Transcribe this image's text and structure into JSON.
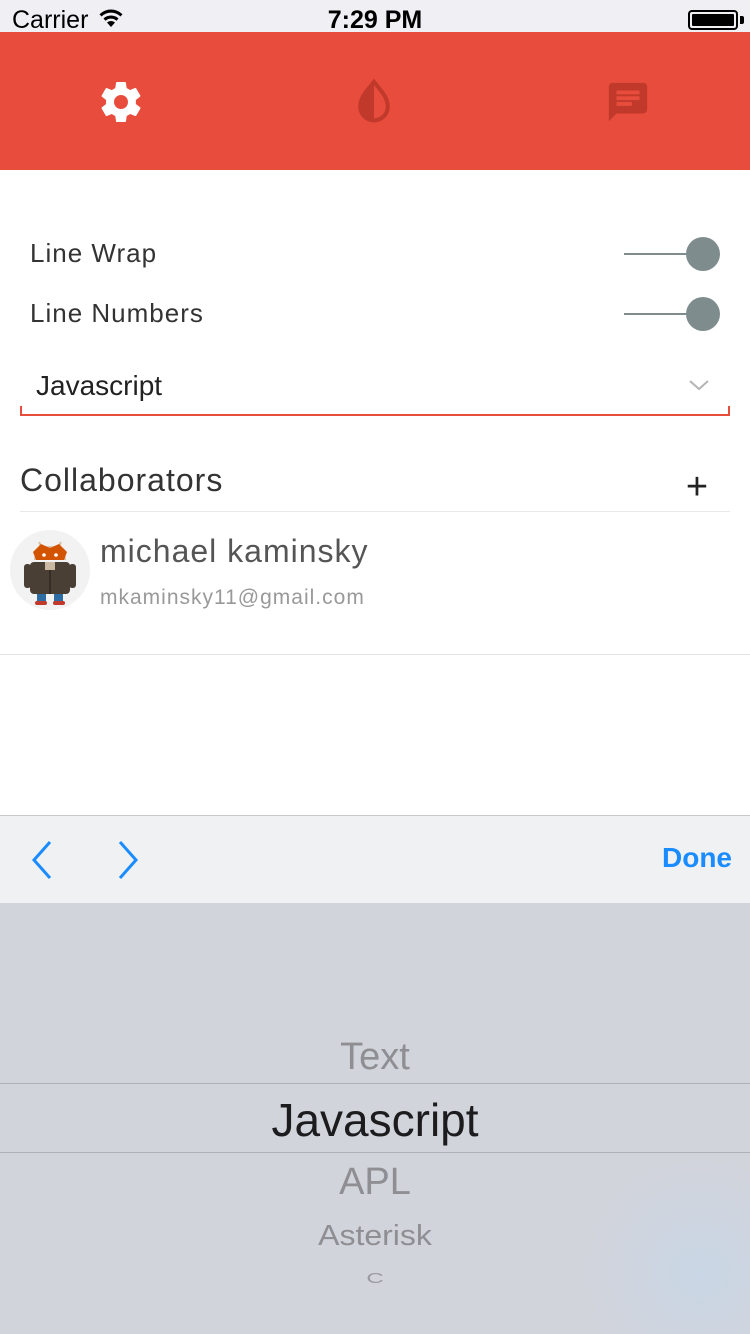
{
  "status_bar": {
    "carrier": "Carrier",
    "time": "7:29 PM",
    "battery_level": 1.0
  },
  "toolbar": {
    "accent_color": "#e84c3d",
    "icons": [
      "gear-icon",
      "contrast-drop-icon",
      "chat-icon"
    ]
  },
  "settings": {
    "line_wrap": {
      "label": "Line Wrap",
      "enabled": true
    },
    "line_numbers": {
      "label": "Line Numbers",
      "enabled": true
    },
    "language": {
      "value": "Javascript"
    }
  },
  "collaborators": {
    "title": "Collaborators",
    "add_label": "+",
    "items": [
      {
        "name": "michael kaminsky",
        "email": "mkaminsky11@gmail.com"
      }
    ]
  },
  "keyboard_accessory": {
    "done_label": "Done",
    "accent_color": "#1a8cff"
  },
  "picker": {
    "options": [
      "Text",
      "Javascript",
      "APL",
      "Asterisk",
      "C"
    ],
    "selected": "Javascript"
  }
}
